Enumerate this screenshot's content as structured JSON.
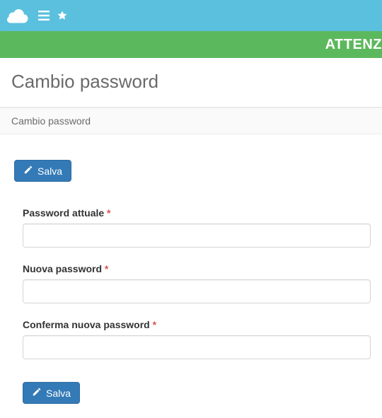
{
  "banner": {
    "text": "ATTENZ"
  },
  "page": {
    "title": "Cambio password",
    "breadcrumb": "Cambio password"
  },
  "actions": {
    "save_label": "Salva"
  },
  "form": {
    "current_password": {
      "label": "Password attuale",
      "value": ""
    },
    "new_password": {
      "label": "Nuova password",
      "value": ""
    },
    "confirm_password": {
      "label": "Conferma nuova password",
      "value": ""
    },
    "required_marker": "*"
  },
  "colors": {
    "topbar": "#5bc0de",
    "banner": "#5cb85c",
    "primary": "#337ab7",
    "danger": "#d9534f"
  }
}
